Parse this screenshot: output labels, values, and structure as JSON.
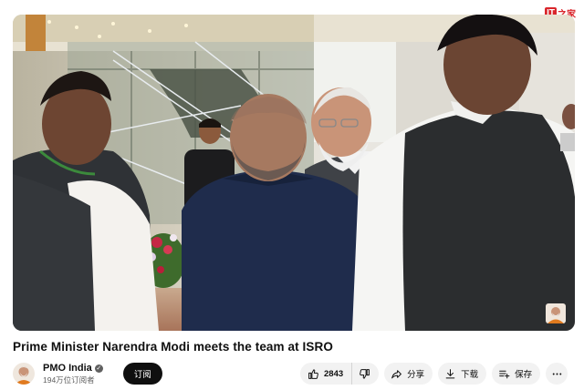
{
  "watermark": {
    "it": "IT",
    "text": "之家"
  },
  "video": {
    "title": "Prime Minister Narendra Modi meets the team at ISRO"
  },
  "channel": {
    "name": "PMO India",
    "subscribers": "194万位订阅者",
    "subscribe_label": "订阅"
  },
  "actions": {
    "like_count": "2843",
    "share_label": "分享",
    "download_label": "下载",
    "save_label": "保存"
  },
  "icons": {
    "like": "thumbs-up-icon",
    "dislike": "thumbs-down-icon",
    "share": "share-arrow-icon",
    "download": "download-icon",
    "save": "playlist-add-icon",
    "more": "more-horizontal-icon",
    "verified": "verified-check-icon"
  },
  "colors": {
    "subscribe_bg": "#0f0f0f",
    "pill_bg": "#f2f2f2",
    "secondary_text": "#606060",
    "watermark_red": "#d9262c"
  }
}
